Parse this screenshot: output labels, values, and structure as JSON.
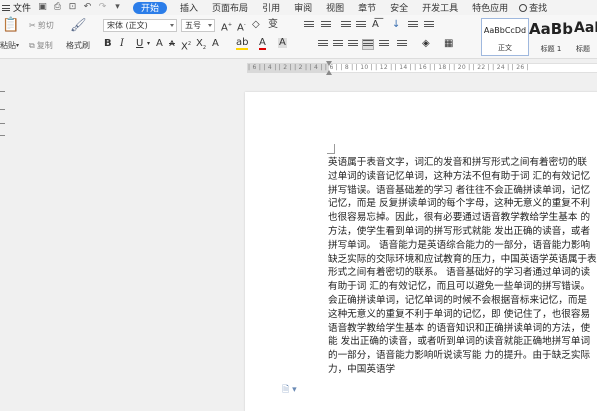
{
  "menubar": {
    "file_label": "文件",
    "tabs": [
      "开始",
      "插入",
      "页面布局",
      "引用",
      "审阅",
      "视图",
      "章节",
      "安全",
      "开发工具",
      "特色应用"
    ],
    "active_tab": "开始",
    "search_label": "查找"
  },
  "ribbon": {
    "paste_label": "粘贴",
    "cut_label": "剪切",
    "copy_label": "复制",
    "format_painter_label": "格式刷",
    "font_name": "宋体 (正文)",
    "font_size": "五号",
    "bold": "B",
    "italic": "I",
    "underline": "U",
    "styles": [
      {
        "sample": "AaBbCcDd",
        "name": "正文"
      },
      {
        "sample": "AaBb",
        "name": "标题 1"
      },
      {
        "sample": "AaBl",
        "name": "标题"
      }
    ]
  },
  "ruler": {
    "numbers": "| 6 |  | 4 |  | 2 |       | 2 |  | 4 |  | 6 |  | 8 |  | 10 |  | 12 |  | 14 |  | 16 |  | 18 |  | 20 |  | 22 |  | 24 |  | 26 |"
  },
  "document": {
    "lines": [
      "英语属于表音文字，词汇的发音和拼写形式之间有着密切的联",
      "过单词的读音记忆单词，这种方法不但有助于词 汇的有效记忆",
      "拼写错误。语音基础差的学习 者往往不会正确拼读单词，记忆",
      "记忆，而是 反复拼读单词的每个字母，这种无意义的重复不利",
      "也很容易忘掉。因此，很有必要通过语音教学教给学生基本 的",
      "方法，使学生看到单词的拼写形式就能 发出正确的读音，或者",
      "拼写单词。 语音能力是英语综合能力的一部分，语音能力影响",
      "缺乏实际的交际环境和应试教育的压力，中国英语学英语属于表",
      "形式之间有着密切的联系。 语音基础好的学习者通过单词的读",
      "有助于词 汇的有效记忆，而且可以避免一些单词的拼写错误。",
      "会正确拼读单词，记忆单词的时候不会根据音标来记忆，而是",
      "这种无意义的重复不利于单词的记忆，即 使记住了，也很容易",
      "语音教学教给学生基本 的语音知识和正确拼读单词的方法，使",
      "能 发出正确的读音，或者听到单词的读音就能正确地拼写单词",
      "的一部分，语音能力影响听说读写能 力的提升。由于缺乏实际",
      "力，中国英语学"
    ]
  }
}
